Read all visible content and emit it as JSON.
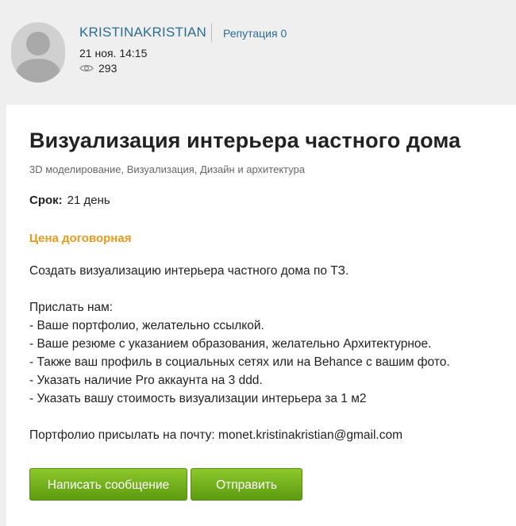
{
  "header": {
    "author": "KRISTINAKRISTIAN",
    "reputation": "Репутация 0",
    "date": "21 ноя. 14:15",
    "views": "293"
  },
  "post": {
    "title": "Визуализация интерьера частного дома",
    "categories": "3D моделирование, Визуализация, Дизайн и архитектура",
    "deadline_label": "Срок:",
    "deadline_value": "21 день",
    "price": "Цена договорная",
    "description": [
      "Создать визуализацию интерьера частного дома по ТЗ.",
      "",
      "Прислать нам:",
      "- Ваше портфолио, желательно ссылкой.",
      "- Ваше резюме с указанием образования, желательно Архитектурное.",
      "- Также ваш профиль в социальных сетях или на Behance с вашим фото.",
      "- Указать наличие Pro аккаунта на 3 ddd.",
      "- Указать вашу стоимость визуализации интерьера за 1 м2",
      "",
      "Портфолио присылать на почту: monet.kristinakristian@gmail.com"
    ]
  },
  "buttons": {
    "message": "Написать сообщение",
    "send": "Отправить"
  },
  "colors": {
    "link": "#2a6d93",
    "price": "#e89a1e",
    "button_top": "#8dc82b",
    "button_bottom": "#5c9a10"
  },
  "icons": {
    "avatar": "default-user-avatar",
    "views": "eye-icon"
  }
}
